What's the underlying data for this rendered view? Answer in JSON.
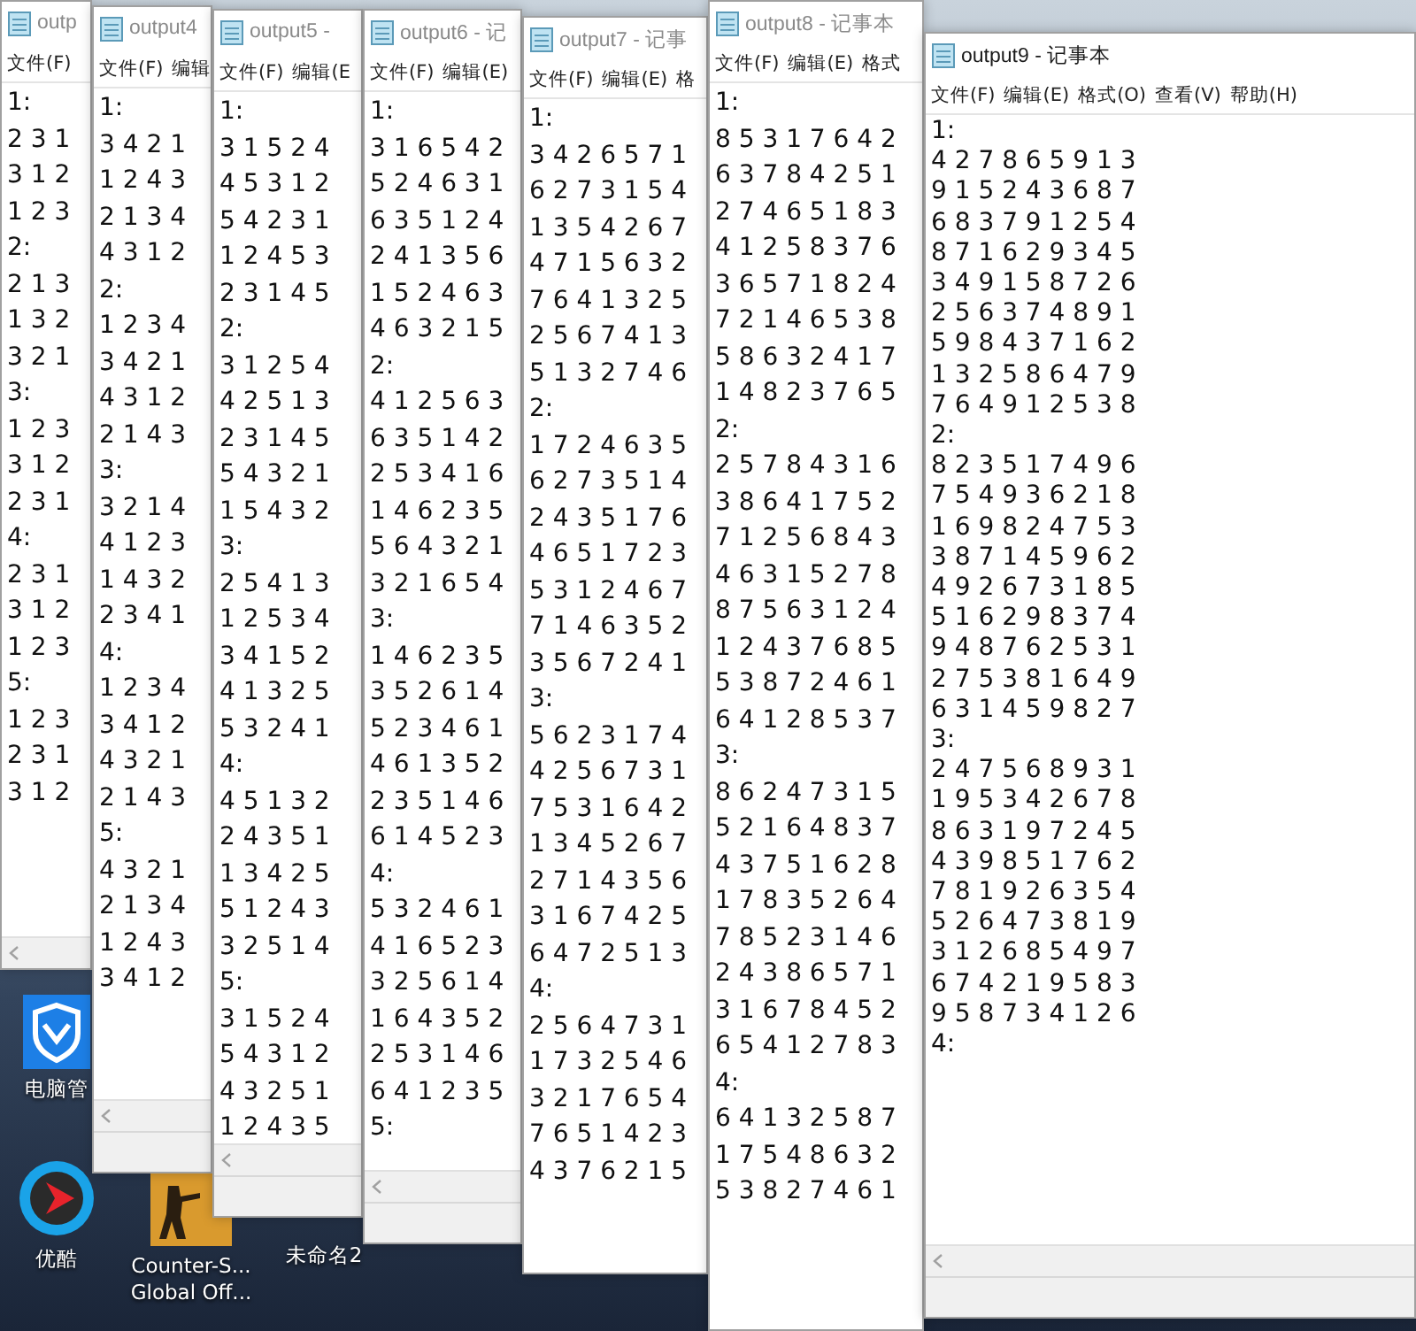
{
  "windows": [
    {
      "title": "outp",
      "active": false,
      "menu": [
        "文件(F)"
      ],
      "blocks": [
        {
          "label": "1:",
          "rows": [
            "2 3 1",
            "3 1 2",
            "1 2 3"
          ]
        },
        {
          "label": "2:",
          "rows": [
            "2 1 3",
            "1 3 2",
            "3 2 1"
          ]
        },
        {
          "label": "3:",
          "rows": [
            "1 2 3",
            "3 1 2",
            "2 3 1"
          ]
        },
        {
          "label": "4:",
          "rows": [
            "2 3 1",
            "3 1 2",
            "1 2 3"
          ]
        },
        {
          "label": "5:",
          "rows": [
            "1 2 3",
            "2 3 1",
            "3 1 2"
          ]
        }
      ]
    },
    {
      "title": "output4",
      "active": false,
      "menu": [
        "文件(F)",
        "编辑"
      ],
      "blocks": [
        {
          "label": "1:",
          "rows": [
            "3 4 2 1",
            "1 2 4 3",
            "2 1 3 4",
            "4 3 1 2"
          ]
        },
        {
          "label": "2:",
          "rows": [
            "1 2 3 4",
            "3 4 2 1",
            "4 3 1 2",
            "2 1 4 3"
          ]
        },
        {
          "label": "3:",
          "rows": [
            "3 2 1 4",
            "4 1 2 3",
            "1 4 3 2",
            "2 3 4 1"
          ]
        },
        {
          "label": "4:",
          "rows": [
            "1 2 3 4",
            "3 4 1 2",
            "4 3 2 1",
            "2 1 4 3"
          ]
        },
        {
          "label": "5:",
          "rows": [
            "4 3 2 1",
            "2 1 3 4",
            "1 2 4 3",
            "3 4 1 2"
          ]
        }
      ]
    },
    {
      "title": "output5 -",
      "active": false,
      "menu": [
        "文件(F)",
        "编辑(E"
      ],
      "blocks": [
        {
          "label": "1:",
          "rows": [
            "3 1 5 2 4",
            "4 5 3 1 2",
            "5 4 2 3 1",
            "1 2 4 5 3",
            "2 3 1 4 5"
          ]
        },
        {
          "label": "2:",
          "rows": [
            "3 1 2 5 4",
            "4 2 5 1 3",
            "2 3 1 4 5",
            "5 4 3 2 1",
            "1 5 4 3 2"
          ]
        },
        {
          "label": "3:",
          "rows": [
            "2 5 4 1 3",
            "1 2 5 3 4",
            "3 4 1 5 2",
            "4 1 3 2 5",
            "5 3 2 4 1"
          ]
        },
        {
          "label": "4:",
          "rows": [
            "4 5 1 3 2",
            "2 4 3 5 1",
            "1 3 4 2 5",
            "5 1 2 4 3",
            "3 2 5 1 4"
          ]
        },
        {
          "label": "5:",
          "rows": [
            "3 1 5 2 4",
            "5 4 3 1 2",
            "4 3 2 5 1",
            "1 2 4 3 5"
          ]
        }
      ]
    },
    {
      "title": "output6 - 记",
      "active": false,
      "menu": [
        "文件(F)",
        "编辑(E)"
      ],
      "blocks": [
        {
          "label": "1:",
          "rows": [
            "3 1 6 5 4 2",
            "5 2 4 6 3 1",
            "6 3 5 1 2 4",
            "2 4 1 3 5 6",
            "1 5 2 4 6 3",
            "4 6 3 2 1 5"
          ]
        },
        {
          "label": "2:",
          "rows": [
            "4 1 2 5 6 3",
            "6 3 5 1 4 2",
            "2 5 3 4 1 6",
            "1 4 6 2 3 5",
            "5 6 4 3 2 1",
            "3 2 1 6 5 4"
          ]
        },
        {
          "label": "3:",
          "rows": [
            "1 4 6 2 3 5",
            "3 5 2 6 1 4",
            "5 2 3 4 6 1",
            "4 6 1 3 5 2",
            "2 3 5 1 4 6",
            "6 1 4 5 2 3"
          ]
        },
        {
          "label": "4:",
          "rows": [
            "5 3 2 4 6 1",
            "4 1 6 5 2 3",
            "3 2 5 6 1 4",
            "1 6 4 3 5 2",
            "2 5 3 1 4 6",
            "6 4 1 2 3 5"
          ]
        },
        {
          "label": "5:"
        }
      ]
    },
    {
      "title": "output7 - 记事",
      "active": false,
      "menu": [
        "文件(F)",
        "编辑(E)",
        "格"
      ],
      "blocks": [
        {
          "label": "1:",
          "rows": [
            "3 4 2 6 5 7 1",
            "6 2 7 3 1 5 4",
            "1 3 5 4 2 6 7",
            "4 7 1 5 6 3 2",
            "7 6 4 1 3 2 5",
            "2 5 6 7 4 1 3",
            "5 1 3 2 7 4 6"
          ]
        },
        {
          "label": "2:",
          "rows": [
            "1 7 2 4 6 3 5",
            "6 2 7 3 5 1 4",
            "2 4 3 5 1 7 6",
            "4 6 5 1 7 2 3",
            "5 3 1 2 4 6 7",
            "7 1 4 6 3 5 2",
            "3 5 6 7 2 4 1"
          ]
        },
        {
          "label": "3:",
          "rows": [
            "5 6 2 3 1 7 4",
            "4 2 5 6 7 3 1",
            "7 5 3 1 6 4 2",
            "1 3 4 5 2 6 7",
            "2 7 1 4 3 5 6",
            "3 1 6 7 4 2 5",
            "6 4 7 2 5 1 3"
          ]
        },
        {
          "label": "4:",
          "rows": [
            "2 5 6 4 7 3 1",
            "1 7 3 2 5 4 6",
            "3 2 1 7 6 5 4",
            "7 6 5 1 4 2 3",
            "4 3 7 6 2 1 5"
          ]
        }
      ]
    },
    {
      "title": "output8 - 记事本",
      "active": false,
      "menu": [
        "文件(F)",
        "编辑(E)",
        "格式"
      ],
      "blocks": [
        {
          "label": "1:",
          "rows": [
            "8 5 3 1 7 6 4 2",
            "6 3 7 8 4 2 5 1",
            "2 7 4 6 5 1 8 3",
            "4 1 2 5 8 3 7 6",
            "3 6 5 7 1 8 2 4",
            "7 2 1 4 6 5 3 8",
            "5 8 6 3 2 4 1 7",
            "1 4 8 2 3 7 6 5"
          ]
        },
        {
          "label": "2:",
          "rows": [
            "2 5 7 8 4 3 1 6",
            "3 8 6 4 1 7 5 2",
            "7 1 2 5 6 8 4 3",
            "4 6 3 1 5 2 7 8",
            "8 7 5 6 3 1 2 4",
            "1 2 4 3 7 6 8 5",
            "5 3 8 7 2 4 6 1",
            "6 4 1 2 8 5 3 7"
          ]
        },
        {
          "label": "3:",
          "rows": [
            "8 6 2 4 7 3 1 5",
            "5 2 1 6 4 8 3 7",
            "4 3 7 5 1 6 2 8",
            "1 7 8 3 5 2 6 4",
            "7 8 5 2 3 1 4 6",
            "2 4 3 8 6 5 7 1",
            "3 1 6 7 8 4 5 2",
            "6 5 4 1 2 7 8 3"
          ]
        },
        {
          "label": "4:",
          "rows": [
            "6 4 1 3 2 5 8 7",
            "1 7 5 4 8 6 3 2",
            "5 3 8 2 7 4 6 1"
          ]
        }
      ]
    },
    {
      "title": "output9 - 记事本",
      "active": true,
      "menu": [
        "文件(F)",
        "编辑(E)",
        "格式(O)",
        "查看(V)",
        "帮助(H)"
      ],
      "blocks": [
        {
          "label": "1:",
          "rows": [
            "4 2 7 8 6 5 9 1 3",
            "9 1 5 2 4 3 6 8 7",
            "6 8 3 7 9 1 2 5 4",
            "8 7 1 6 2 9 3 4 5",
            "3 4 9 1 5 8 7 2 6",
            "2 5 6 3 7 4 8 9 1",
            "5 9 8 4 3 7 1 6 2",
            "1 3 2 5 8 6 4 7 9",
            "7 6 4 9 1 2 5 3 8"
          ]
        },
        {
          "label": "2:",
          "rows": [
            "8 2 3 5 1 7 4 9 6",
            "7 5 4 9 3 6 2 1 8",
            "1 6 9 8 2 4 7 5 3",
            "3 8 7 1 4 5 9 6 2",
            "4 9 2 6 7 3 1 8 5",
            "5 1 6 2 9 8 3 7 4",
            "9 4 8 7 6 2 5 3 1",
            "2 7 5 3 8 1 6 4 9",
            "6 3 1 4 5 9 8 2 7"
          ]
        },
        {
          "label": "3:",
          "rows": [
            "2 4 7 5 6 8 9 3 1",
            "1 9 5 3 4 2 6 7 8",
            "8 6 3 1 9 7 2 4 5",
            "4 3 9 8 5 1 7 6 2",
            "7 8 1 9 2 6 3 5 4",
            "5 2 6 4 7 3 8 1 9",
            "3 1 2 6 8 5 4 9 7",
            "6 7 4 2 1 9 5 8 3",
            "9 5 8 7 3 4 1 2 6"
          ]
        },
        {
          "label": "4:"
        }
      ]
    }
  ],
  "desktop_icons": [
    {
      "kind": "shield",
      "label": "电脑管"
    },
    {
      "kind": "player",
      "label": "优酷"
    },
    {
      "kind": "game",
      "label": "Counter-S...\nGlobal Off..."
    },
    {
      "kind": "blank",
      "label": "未命名2"
    }
  ]
}
